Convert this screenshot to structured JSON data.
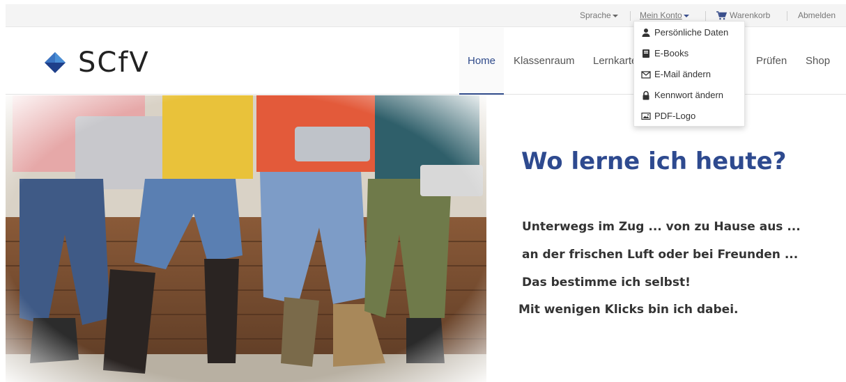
{
  "topbar": {
    "language": "Sprache",
    "account": "Mein Konto",
    "cart": "Warenkorb",
    "logout": "Abmelden"
  },
  "brand": {
    "name": "SCfV",
    "colors": {
      "diamond_light": "#4a8fd6",
      "diamond_dark": "#1e3f8a"
    }
  },
  "nav": {
    "items": [
      {
        "label": "Home",
        "active": true
      },
      {
        "label": "Klassenraum"
      },
      {
        "label": "Lernkarten"
      },
      {
        "label": "Prüfen"
      },
      {
        "label": "Shop"
      }
    ]
  },
  "account_menu": {
    "items": [
      {
        "label": "Persönliche Daten",
        "icon": "user-icon"
      },
      {
        "label": "E-Books",
        "icon": "book-icon"
      },
      {
        "label": "E-Mail ändern",
        "icon": "envelope-icon"
      },
      {
        "label": "Kennwort ändern",
        "icon": "lock-icon"
      },
      {
        "label": "PDF-Logo",
        "icon": "image-icon"
      }
    ]
  },
  "hero": {
    "headline": "Wo lerne ich heute?",
    "lines": [
      "Unterwegs im Zug ... von zu Hause aus ...",
      "an der frischen Luft oder bei Freunden ...",
      "Das bestimme ich selbst!",
      "Mit wenigen Klicks bin ich dabei."
    ]
  },
  "colors": {
    "accent": "#2e4a8f",
    "link": "#3a4f8c",
    "topbar_bg": "#f4f4f4"
  }
}
